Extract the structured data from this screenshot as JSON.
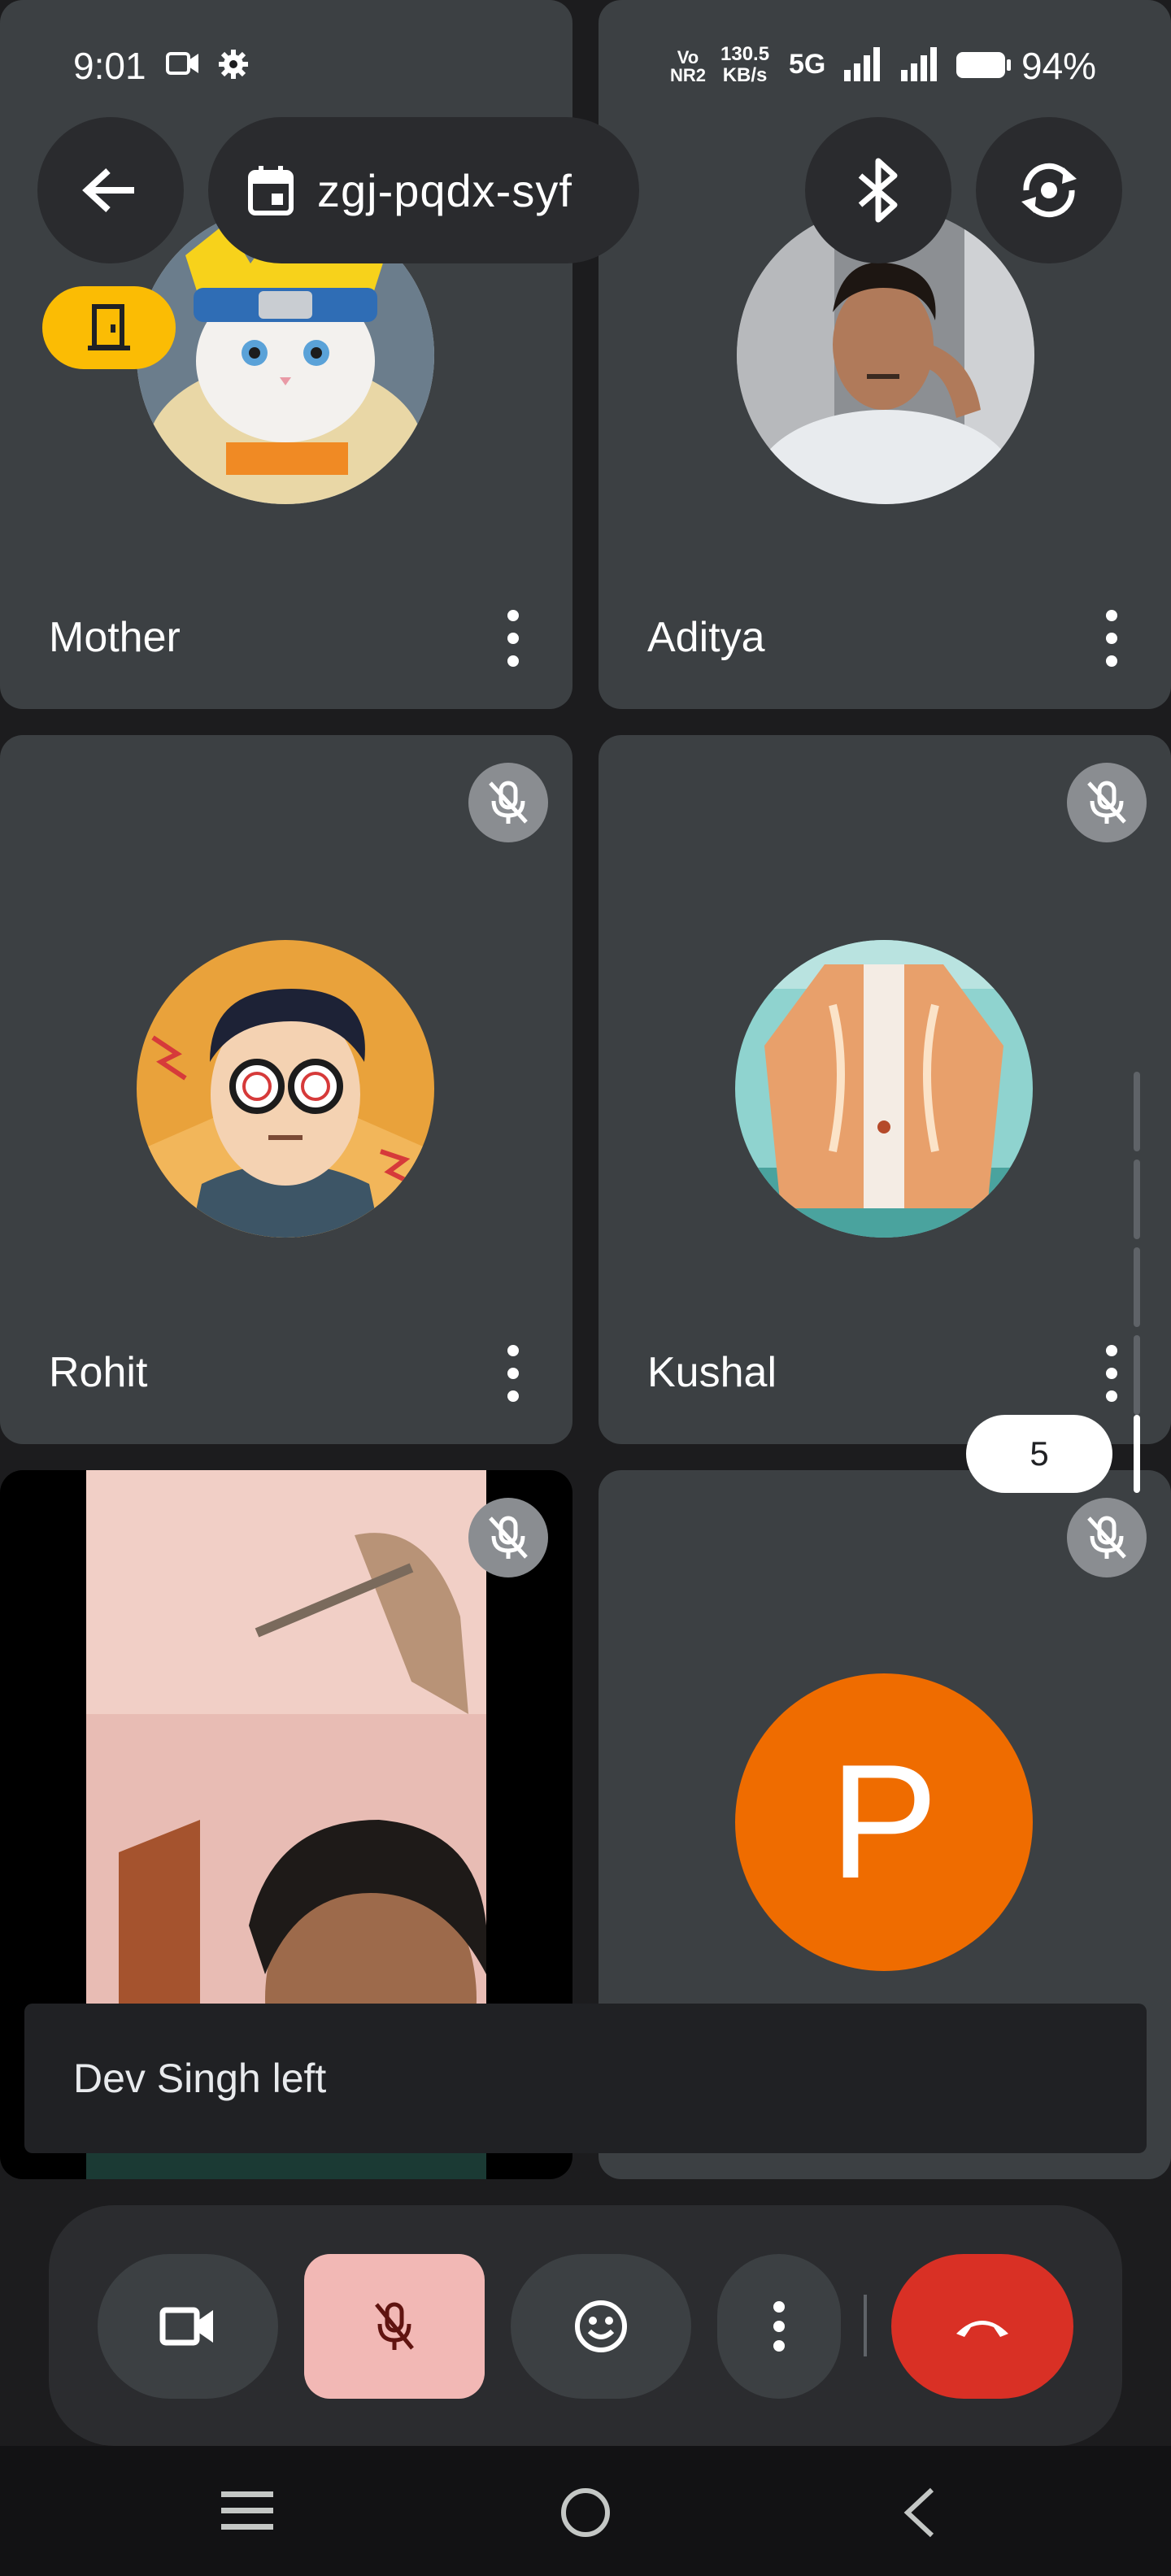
{
  "status_bar": {
    "time": "9:01",
    "speed_top": "130.5",
    "speed_unit": "KB/s",
    "network": "5G",
    "vo_label": "Vo",
    "nr_label": "NR2",
    "battery": "94%"
  },
  "header": {
    "meeting_code": "zgj-pqdx-syf"
  },
  "participants": [
    {
      "name": "Mother",
      "avatar": "cat-avatar",
      "muted": false
    },
    {
      "name": "Aditya",
      "avatar": "photo-avatar",
      "muted": false
    },
    {
      "name": "Rohit",
      "avatar": "cartoon-avatar",
      "muted": true
    },
    {
      "name": "Kushal",
      "avatar": "jacket-avatar",
      "muted": true
    },
    {
      "name": "",
      "avatar": "video-feed",
      "muted": true
    },
    {
      "name": "",
      "avatar_letter": "P",
      "muted": true
    }
  ],
  "scroll_indicator": {
    "page": "5"
  },
  "toast": {
    "message": "Dev Singh left"
  },
  "colors": {
    "tile_bg": "#3c4043",
    "mute_active": "#f2b8b5",
    "hangup": "#d93025",
    "avatar_p": "#ef6c00",
    "host_badge": "#fbbc04"
  }
}
